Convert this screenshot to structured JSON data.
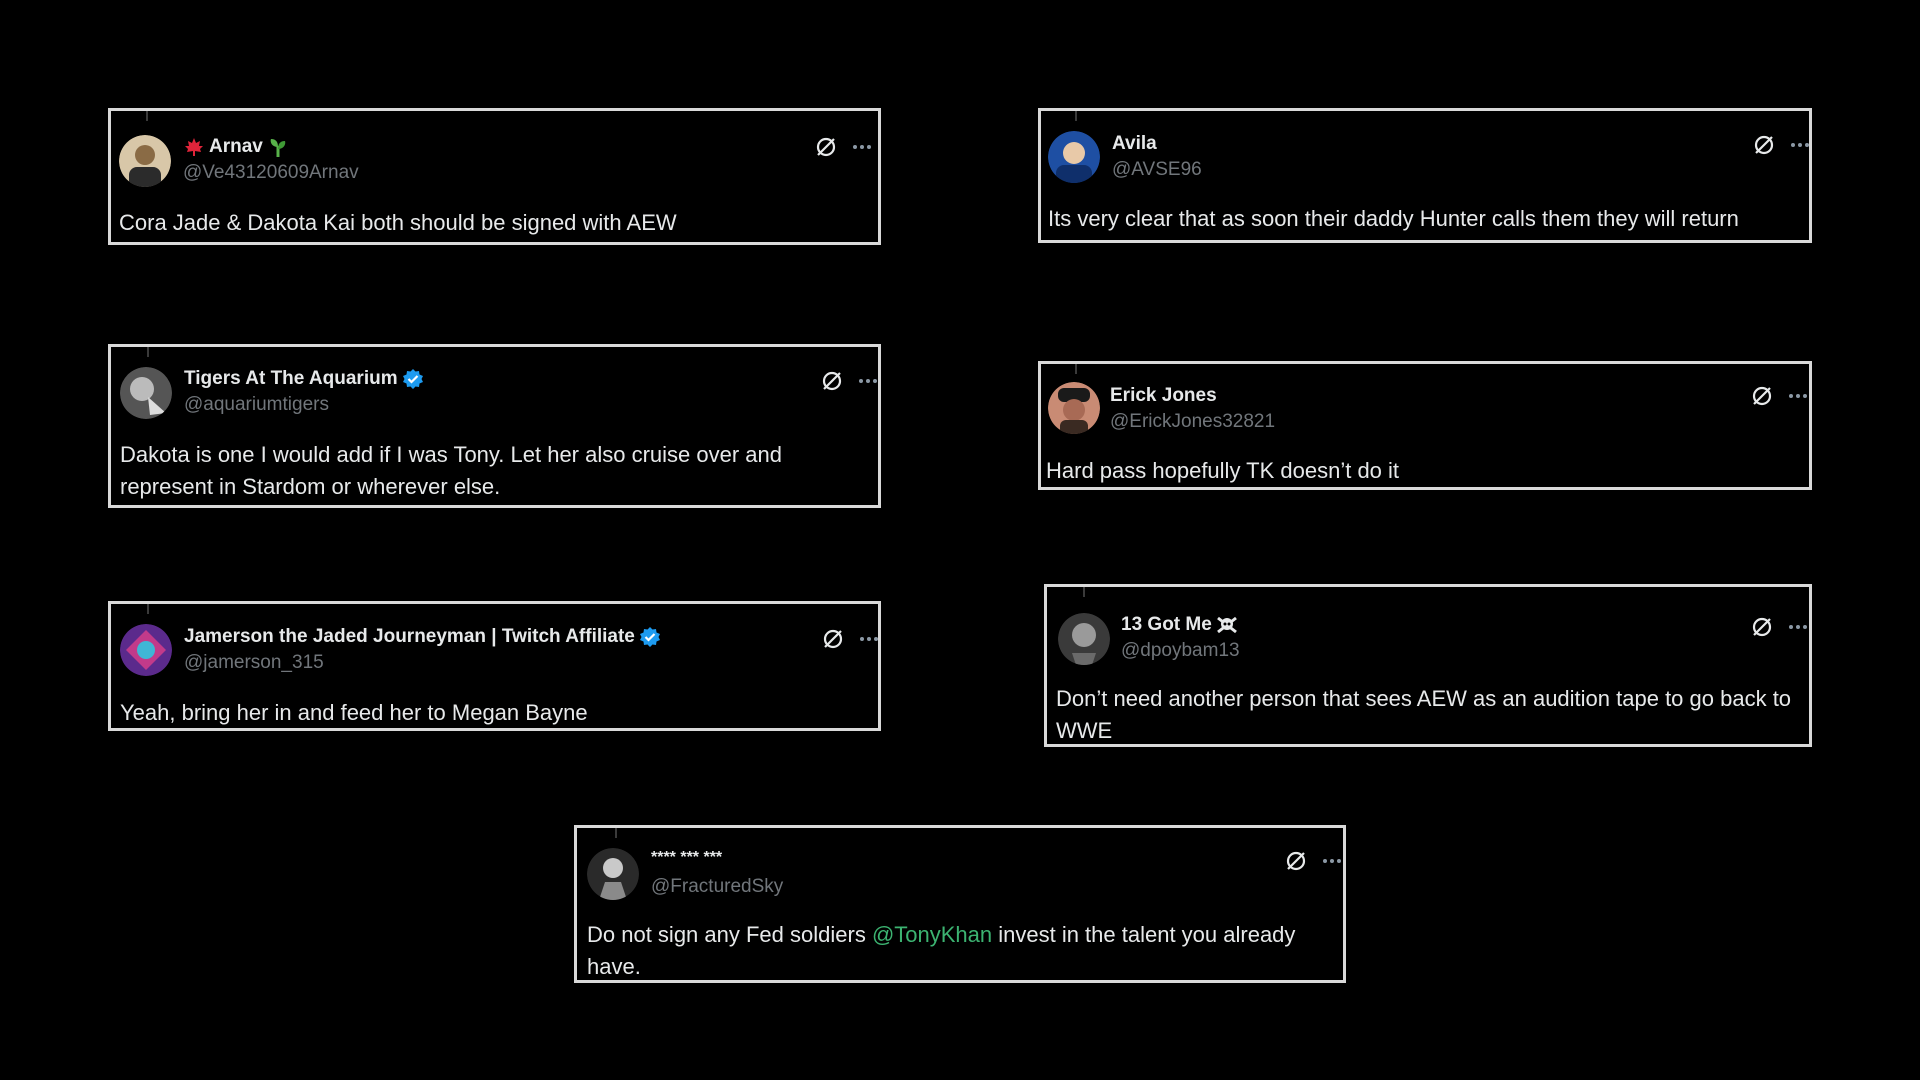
{
  "tweets": [
    {
      "name": "Arnav",
      "handle": "@Ve43120609Arnav",
      "text": "Cora Jade & Dakota Kai both should be signed with AEW",
      "badges": [
        "maple-leaf-flag-icon",
        "seedling-icon"
      ],
      "avatar_colors": [
        "#8a6b45",
        "#d8c7a8"
      ]
    },
    {
      "name": "Avila",
      "handle": "@AVSE96",
      "text": "Its very clear that as soon their daddy Hunter calls them they will return",
      "badges": [],
      "avatar_colors": [
        "#1e4fa3",
        "#e8c9a8"
      ]
    },
    {
      "name": "Tigers At The Aquarium",
      "handle": "@aquariumtigers",
      "text": "Dakota is one I would add if I was Tony. Let her also cruise over and represent in Stardom or wherever else.",
      "badges": [
        "verified-icon"
      ],
      "avatar_colors": [
        "#555555",
        "#bbbbbb"
      ]
    },
    {
      "name": "Erick Jones",
      "handle": "@ErickJones32821",
      "text": "Hard pass hopefully TK doesn’t do it",
      "badges": [],
      "avatar_colors": [
        "#3a2a22",
        "#c98b74"
      ]
    },
    {
      "name": "Jamerson the Jaded Journeyman | Twitch Affiliate",
      "handle": "@jamerson_315",
      "text": "Yeah, bring her in and feed her to Megan Bayne",
      "badges": [
        "verified-icon"
      ],
      "avatar_colors": [
        "#5b2a8c",
        "#c23a8a"
      ]
    },
    {
      "name": "13 Got Me",
      "handle": "@dpoybam13",
      "text": "Don’t need another person that sees AEW as an audition tape to go back to WWE",
      "badges": [
        "skull-crossbones-icon"
      ],
      "avatar_colors": [
        "#3a3a3a",
        "#9a9a9a"
      ]
    },
    {
      "name": "**** *** ***",
      "handle": "@FracturedSky",
      "text_before": "Do not sign any Fed soldiers ",
      "mention": "@TonyKhan",
      "text_after": " invest in the talent you already have.",
      "badges": [],
      "avatar_colors": [
        "#2a2a2a",
        "#c9c9c9"
      ]
    }
  ],
  "colors": {
    "background": "#000000",
    "border": "#d9d9d9",
    "text": "#e7e9ea",
    "handle": "#71767b",
    "mention": "#3cb371",
    "verified": "#1d9bf0"
  }
}
